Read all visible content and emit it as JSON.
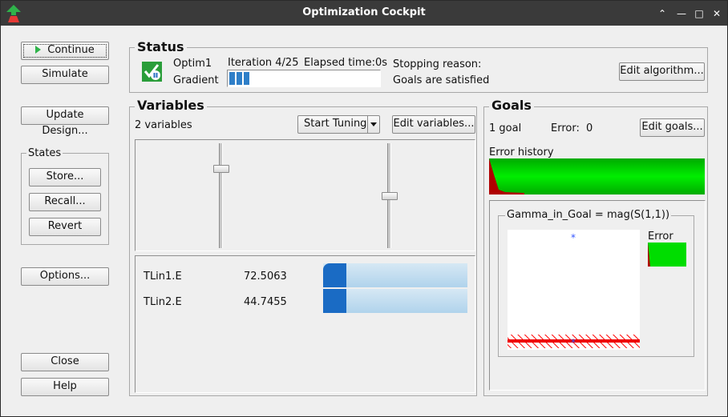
{
  "window": {
    "title": "Optimization Cockpit"
  },
  "left": {
    "continue_label": "Continue",
    "simulate_label": "Simulate",
    "update_design_label": "Update Design...",
    "states": {
      "title": "States",
      "store_label": "Store...",
      "recall_label": "Recall...",
      "revert_label": "Revert"
    },
    "options_label": "Options...",
    "close_label": "Close",
    "help_label": "Help"
  },
  "status": {
    "title": "Status",
    "algorithm_name": "Optim1",
    "method": "Gradient",
    "iteration": "Iteration 4/25",
    "elapsed": "Elapsed time:0s",
    "progress_fraction": 0.16,
    "stopping_reason_label": "Stopping reason:",
    "stopping_reason": "Goals are satisfied",
    "edit_algorithm_label": "Edit algorithm..."
  },
  "variables": {
    "title": "Variables",
    "count_text": "2 variables",
    "start_tuning_label": "Start Tuning",
    "edit_variables_label": "Edit variables...",
    "sliders": [
      {
        "value": 0.78
      },
      {
        "value": 0.5
      }
    ],
    "items": [
      {
        "name": "TLin1.E",
        "value": "72.5063",
        "bar_fraction": 0.16
      },
      {
        "name": "TLin2.E",
        "value": "44.7455",
        "bar_fraction": 0.16
      }
    ]
  },
  "goals": {
    "title": "Goals",
    "count_text": "1 goal",
    "error_label": "Error:",
    "error_value": "0",
    "edit_goals_label": "Edit goals...",
    "error_history_label": "Error history",
    "goal_group_title": "Gamma_in_Goal = mag(S(1,1))",
    "error_caption": "Error"
  },
  "colors": {
    "goal_green": "#00cc00",
    "error_red": "#b00000",
    "bar_blue": "#1a6bc4",
    "marker_blue": "#3355ff"
  }
}
